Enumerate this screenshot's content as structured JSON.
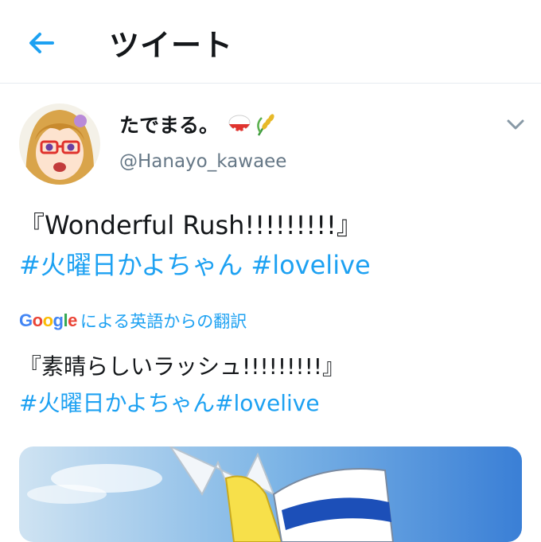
{
  "header": {
    "title": "ツイート"
  },
  "author": {
    "display_name": "たでまる。",
    "handle": "@Hanayo_kawaee",
    "name_emojis": [
      "rice-bowl",
      "rice-plant"
    ]
  },
  "tweet": {
    "text_line1": "『Wonderful Rush!!!!!!!!!』",
    "hashtag1": "#火曜日かよちゃん",
    "hashtag2": "#lovelive"
  },
  "translation": {
    "google": "Google",
    "label": "による英語からの翻訳",
    "text_line1": "『素晴らしいラッシュ!!!!!!!!!』",
    "hashtags": "#火曜日かよちゃん#lovelive"
  },
  "colors": {
    "accent": "#1da1f2",
    "text": "#14171a",
    "muted": "#657786",
    "divider": "#e6ecf0"
  },
  "icons": {
    "back": "arrow-left-icon",
    "menu": "chevron-down-icon"
  }
}
